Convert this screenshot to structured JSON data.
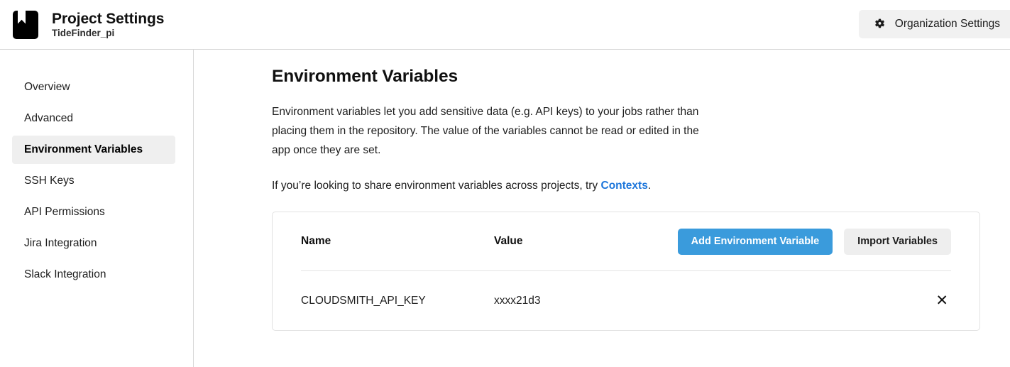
{
  "header": {
    "logo_icon": "bookmark-icon",
    "page_title": "Project Settings",
    "project_name": "TideFinder_pi",
    "org_settings": {
      "icon": "gear-icon",
      "label": "Organization Settings"
    }
  },
  "sidebar": {
    "items": [
      {
        "label": "Overview",
        "active": false
      },
      {
        "label": "Advanced",
        "active": false
      },
      {
        "label": "Environment Variables",
        "active": true
      },
      {
        "label": "SSH Keys",
        "active": false
      },
      {
        "label": "API Permissions",
        "active": false
      },
      {
        "label": "Jira Integration",
        "active": false
      },
      {
        "label": "Slack Integration",
        "active": false
      }
    ]
  },
  "main": {
    "section_title": "Environment Variables",
    "intro_paragraph": "Environment variables let you add sensitive data (e.g. API keys) to your jobs rather than placing them in the repository. The value of the variables cannot be read or edited in the app once they are set.",
    "contexts_text_before": "If you’re looking to share environment variables across projects, try ",
    "contexts_link_label": "Contexts",
    "contexts_text_after": ".",
    "card": {
      "columns": {
        "name": "Name",
        "value": "Value"
      },
      "add_button_label": "Add Environment Variable",
      "import_button_label": "Import Variables",
      "rows": [
        {
          "name": "CLOUDSMITH_API_KEY",
          "value": "xxxx21d3",
          "delete_icon": "close-icon",
          "delete_glyph": "✕"
        }
      ]
    }
  },
  "colors": {
    "primary_button": "#3a9bdc",
    "link": "#1d76db",
    "active_nav_background": "#efefef",
    "secondary_button": "#eeeeee"
  }
}
